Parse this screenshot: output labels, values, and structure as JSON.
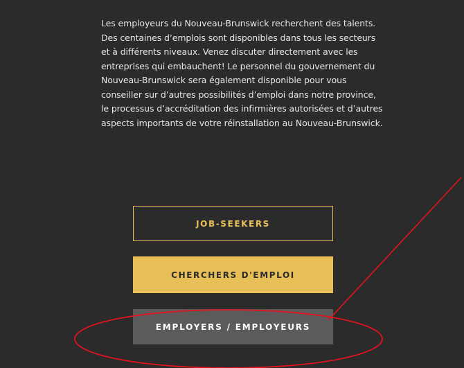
{
  "intro": {
    "text": "Les employeurs du Nouveau-Brunswick recherchent des talents. Des centaines d’emplois sont disponibles dans tous les secteurs et à différents niveaux. Venez discuter directement avec les entreprises qui embauchent! Le personnel du gouvernement du Nouveau-Brunswick sera également disponible pour vous conseiller sur d’autres possibilités d’emploi dans notre province, le processus d’accréditation des infirmières autorisées et d’autres aspects importants de votre réinstallation au Nouveau-Brunswick."
  },
  "buttons": {
    "job_seekers": "JOB-SEEKERS",
    "chercheurs": "CHERCHERS D'EMPLOI",
    "employers": "EMPLOYERS / EMPLOYEURS"
  },
  "colors": {
    "background": "#2b2b2b",
    "accent_gold": "#e8bf57",
    "employers_button": "#5b5b5b",
    "annotation_red": "#e0141e"
  }
}
